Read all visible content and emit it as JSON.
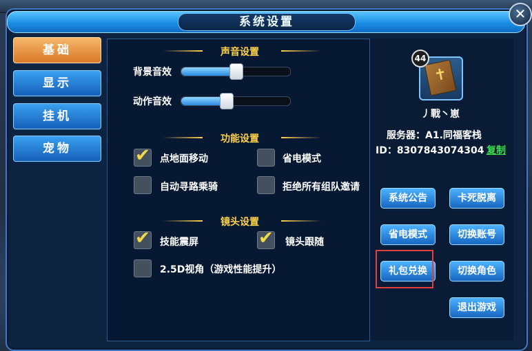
{
  "dialog": {
    "title": "系统设置",
    "close_glyph": "✕"
  },
  "tabs": [
    {
      "label": "基础",
      "active": true
    },
    {
      "label": "显示",
      "active": false
    },
    {
      "label": "挂机",
      "active": false
    },
    {
      "label": "宠物",
      "active": false
    }
  ],
  "sound": {
    "header": "声音设置",
    "bgm_label": "背景音效",
    "bgm_level": 0.5,
    "sfx_label": "动作音效",
    "sfx_level": 0.41
  },
  "function": {
    "header": "功能设置",
    "items": [
      {
        "label": "点地面移动",
        "checked": true
      },
      {
        "label": "省电模式",
        "checked": false
      },
      {
        "label": "自动寻路乘骑",
        "checked": false
      },
      {
        "label": "拒绝所有组队邀请",
        "checked": false
      }
    ]
  },
  "camera": {
    "header": "镜头设置",
    "items": [
      {
        "label": "技能震屏",
        "checked": true
      },
      {
        "label": "镜头跟随",
        "checked": true
      },
      {
        "label": "2.5D视角（游戏性能提升）",
        "checked": false
      }
    ]
  },
  "profile": {
    "level": "44",
    "name": "丿戰丶崽",
    "server": "服务器：A1.同福客栈",
    "id": "ID：8307843074304",
    "copy_label": "复制",
    "avatar_icon": "holy-book-icon"
  },
  "actions": [
    {
      "label": "系统公告"
    },
    {
      "label": "卡死脱离"
    },
    {
      "label": "省电模式"
    },
    {
      "label": "切换账号"
    },
    {
      "label": "礼包兑换"
    },
    {
      "label": "切换角色"
    },
    {
      "label": "退出游戏"
    }
  ],
  "colors": {
    "accent": "#1a8ee4",
    "active_tab": "#d87a28",
    "section_header": "#ffd24a",
    "copy_link": "#39e04a",
    "highlight": "#e2403e"
  }
}
